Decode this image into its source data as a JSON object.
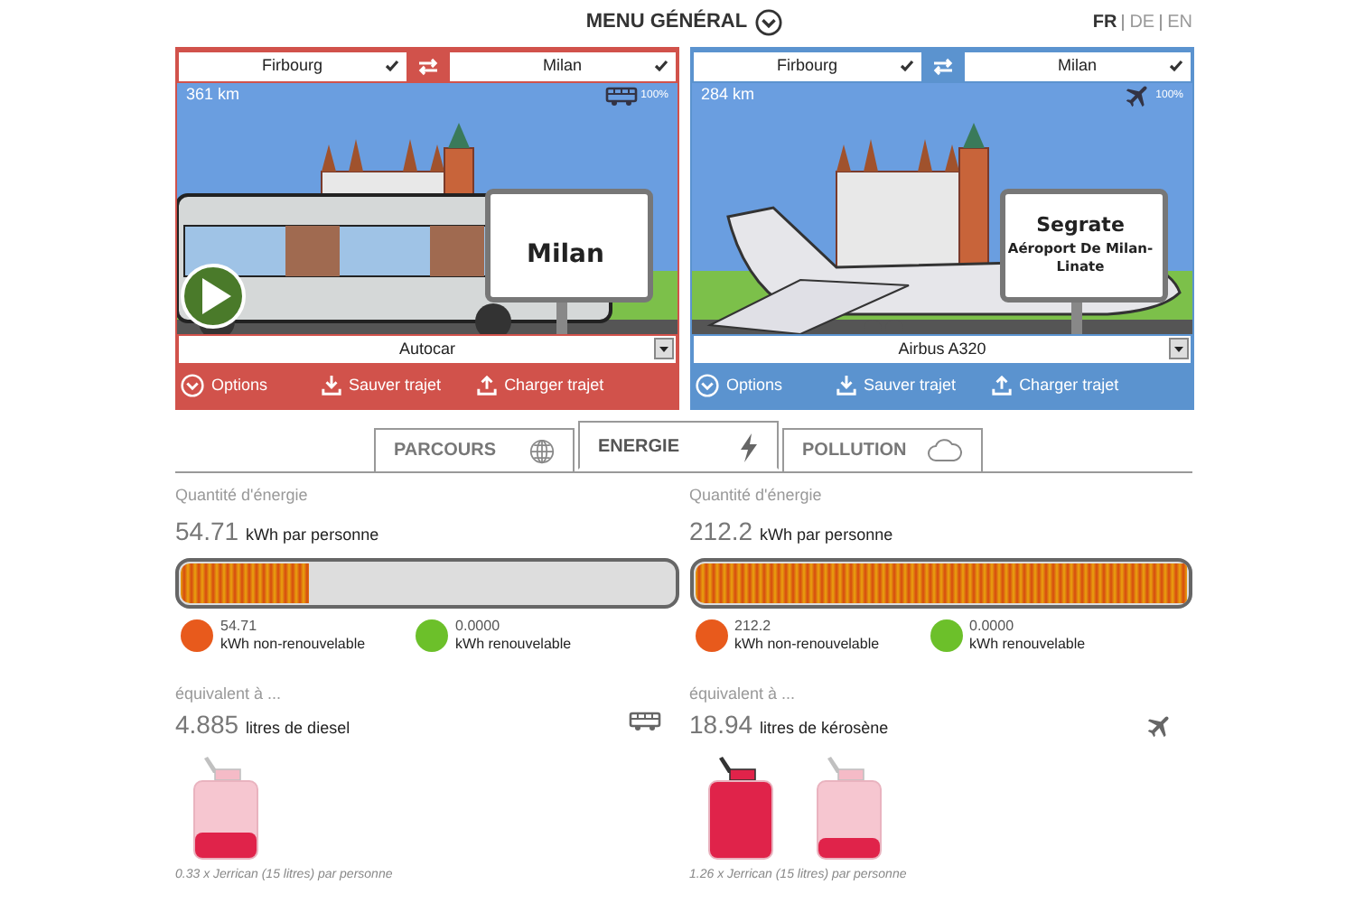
{
  "header": {
    "menu": "MENU GÉNÉRAL",
    "languages": [
      {
        "label": "FR",
        "selected": true
      },
      {
        "label": "DE",
        "selected": false
      },
      {
        "label": "EN",
        "selected": false
      }
    ]
  },
  "panels": [
    {
      "color": "#d1524b",
      "from": "Firbourg",
      "to": "Milan",
      "distance": "361 km",
      "kind": "bus",
      "occupancy": "100%",
      "sign": [
        "Milan"
      ],
      "play": true,
      "vehicle": "Autocar",
      "actions": [
        "Options",
        "Sauver trajet",
        "Charger trajet"
      ]
    },
    {
      "color": "#5b93cf",
      "from": "Firbourg",
      "to": "Milan",
      "distance": "284 km",
      "kind": "plane",
      "occupancy": "100%",
      "sign": [
        "Segrate",
        "Aéroport De Milan-",
        "Linate"
      ],
      "play": false,
      "vehicle": "Airbus A320",
      "actions": [
        "Options",
        "Sauver trajet",
        "Charger trajet"
      ]
    }
  ],
  "tabs": [
    {
      "label": "PARCOURS",
      "kind": "globe",
      "selected": false
    },
    {
      "label": "ENERGIE",
      "kind": "bolt",
      "selected": true
    },
    {
      "label": "POLLUTION",
      "kind": "cloud",
      "selected": false
    }
  ],
  "energy": [
    {
      "caption": "Quantité d'énergie",
      "value": "54.71",
      "unit": "kWh par personne",
      "level": 0.26,
      "legend": [
        {
          "value": "54.71",
          "label": "kWh non-renouvelable",
          "color": "#e85a1c"
        },
        {
          "value": "0.0000",
          "label": "kWh renouvelable",
          "color": "#6cc02a"
        }
      ]
    },
    {
      "caption": "Quantité d'énergie",
      "value": "212.2",
      "unit": "kWh par personne",
      "level": 1,
      "legend": [
        {
          "value": "212.2",
          "label": "kWh non-renouvelable",
          "color": "#e85a1c"
        },
        {
          "value": "0.0000",
          "label": "kWh renouvelable",
          "color": "#6cc02a"
        }
      ]
    }
  ],
  "equivalents": [
    {
      "caption": "équivalent à ...",
      "value": "4.885",
      "unit": "litres de diesel",
      "kind": "bus",
      "cans": [
        {
          "level": 0.33
        }
      ],
      "note": "0.33 x Jerrican (15 litres) par personne"
    },
    {
      "caption": "équivalent à ...",
      "value": "18.94",
      "unit": "litres de kérosène",
      "kind": "plane",
      "cans": [
        {
          "level": 1
        },
        {
          "level": 0.26
        }
      ],
      "note": "1.26 x Jerrican (15 litres) par personne"
    }
  ]
}
